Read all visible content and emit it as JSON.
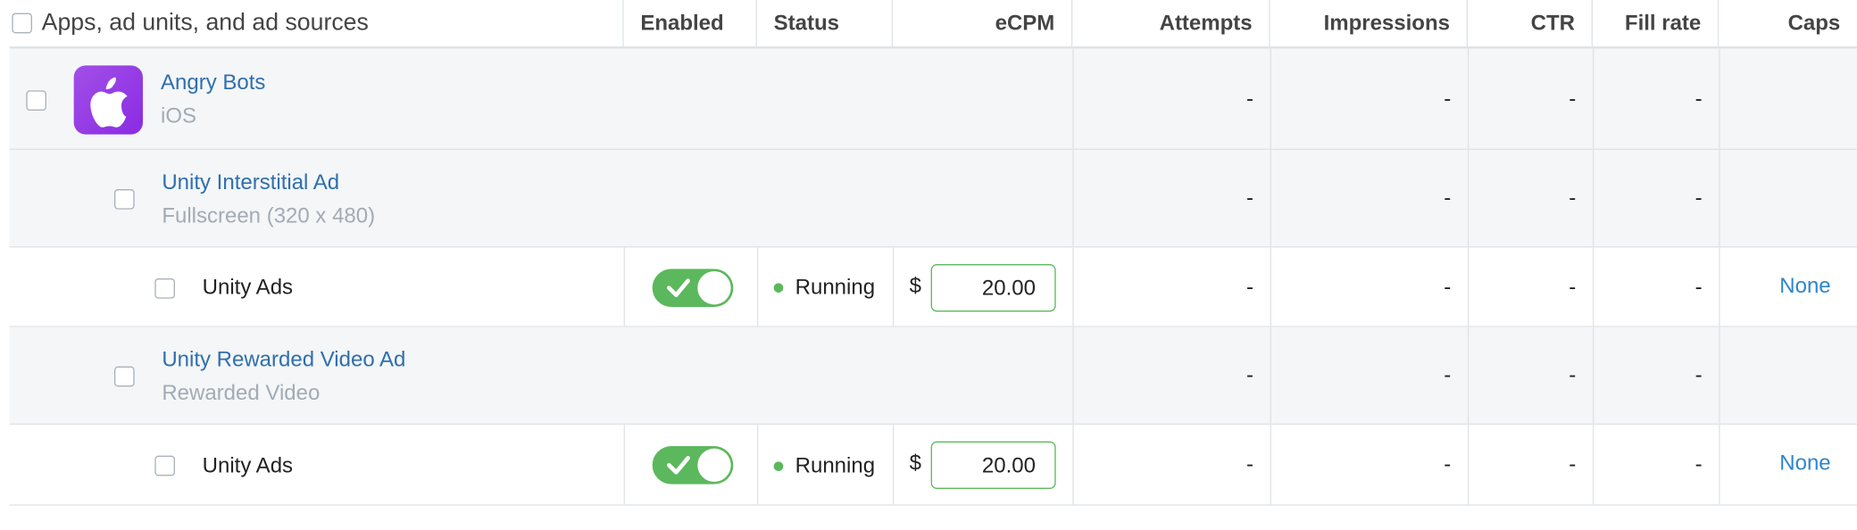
{
  "header": {
    "name_label": "Apps, ad units, and ad sources",
    "enabled": "Enabled",
    "status": "Status",
    "ecpm": "eCPM",
    "attempts": "Attempts",
    "impressions": "Impressions",
    "ctr": "CTR",
    "fill_rate": "Fill rate",
    "caps": "Caps"
  },
  "app": {
    "name": "Angry Bots",
    "platform": "iOS",
    "icon": "apple-icon",
    "attempts": "-",
    "impressions": "-",
    "ctr": "-",
    "fill_rate": "-"
  },
  "ad_units": [
    {
      "name": "Unity Interstitial Ad",
      "format": "Fullscreen (320 x 480)",
      "attempts": "-",
      "impressions": "-",
      "ctr": "-",
      "fill_rate": "-",
      "source": {
        "name": "Unity Ads",
        "enabled": true,
        "status": "Running",
        "currency": "$",
        "ecpm": "20.00",
        "attempts": "-",
        "impressions": "-",
        "ctr": "-",
        "fill_rate": "-",
        "caps": "None"
      }
    },
    {
      "name": "Unity Rewarded Video Ad",
      "format": "Rewarded Video",
      "attempts": "-",
      "impressions": "-",
      "ctr": "-",
      "fill_rate": "-",
      "source": {
        "name": "Unity Ads",
        "enabled": true,
        "status": "Running",
        "currency": "$",
        "ecpm": "20.00",
        "attempts": "-",
        "impressions": "-",
        "ctr": "-",
        "fill_rate": "-",
        "caps": "None"
      }
    }
  ],
  "colors": {
    "accent_green": "#5cb85c",
    "link_blue": "#2f6fad",
    "app_icon_purple": "#8a2be2"
  }
}
